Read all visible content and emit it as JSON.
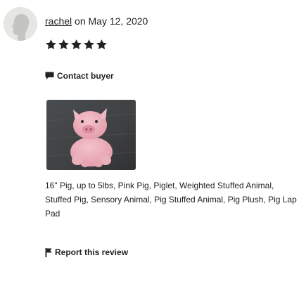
{
  "review": {
    "reviewer_name": "rachel",
    "date_prefix": "on",
    "date": "May 12, 2020",
    "rating": 5,
    "item_title": "16\" Pig, up to 5lbs, Pink Pig, Piglet, Weighted Stuffed Animal, Stuffed Pig, Sensory Animal, Pig Stuffed Animal, Pig Plush, Pig Lap Pad"
  },
  "actions": {
    "contact_label": "Contact buyer",
    "report_label": "Report this review"
  },
  "icons": {
    "star": "star-icon",
    "contact": "message-icon",
    "report": "flag-icon",
    "avatar": "default-avatar-icon"
  },
  "colors": {
    "text": "#222222",
    "star": "#222222",
    "avatar_bg": "#e6e6e3",
    "avatar_fg": "#c4c4c0"
  }
}
